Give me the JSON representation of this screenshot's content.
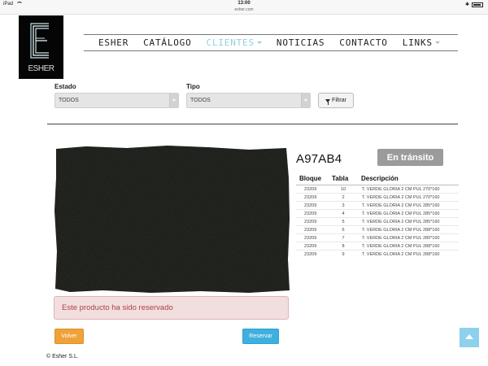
{
  "status_bar": {
    "device": "iPad",
    "time": "13:00",
    "url": "esher.com",
    "battery_icon": "battery-icon",
    "bluetooth": "✱",
    "battery_pct": "",
    "wifi_icon": "wifi-icon"
  },
  "logo": {
    "text": "ESHER"
  },
  "nav": {
    "items": [
      {
        "label": "ESHER",
        "active": false,
        "dropdown": false
      },
      {
        "label": "CATÁLOGO",
        "active": false,
        "dropdown": false
      },
      {
        "label": "CLIENTES",
        "active": true,
        "dropdown": true
      },
      {
        "label": "NOTICIAS",
        "active": false,
        "dropdown": false
      },
      {
        "label": "CONTACTO",
        "active": false,
        "dropdown": false
      },
      {
        "label": "LINKS",
        "active": false,
        "dropdown": true
      }
    ],
    "active_color": "#8fd1e0"
  },
  "filters": {
    "estado_label": "Estado",
    "estado_value": "TODOS",
    "tipo_label": "Tipo",
    "tipo_value": "TODOS",
    "filter_button": "Filtrar"
  },
  "product": {
    "code": "A97AB4",
    "status": "En tránsito",
    "headers": {
      "bloque": "Bloque",
      "tabla": "Tabla",
      "descripcion": "Descripción"
    },
    "rows": [
      {
        "bloque": "23209",
        "tabla": "10",
        "descripcion": "T. VERDE GLORIA 2 CM PUL 270*160"
      },
      {
        "bloque": "23209",
        "tabla": "2",
        "descripcion": "T. VERDE GLORIA 2 CM PUL 270*160"
      },
      {
        "bloque": "23209",
        "tabla": "3",
        "descripcion": "T. VERDE GLORIA 2 CM PUL 285*160"
      },
      {
        "bloque": "23209",
        "tabla": "4",
        "descripcion": "T. VERDE GLORIA 2 CM PUL 285*160"
      },
      {
        "bloque": "23209",
        "tabla": "5",
        "descripcion": "T. VERDE GLORIA 2 CM PUL 285*160"
      },
      {
        "bloque": "23209",
        "tabla": "6",
        "descripcion": "T. VERDE GLORIA 2 CM PUL 288*160"
      },
      {
        "bloque": "23209",
        "tabla": "7",
        "descripcion": "T. VERDE GLORIA 2 CM PUL 280*160"
      },
      {
        "bloque": "23209",
        "tabla": "8",
        "descripcion": "T. VERDE GLORIA 2 CM PUL 288*160"
      },
      {
        "bloque": "23209",
        "tabla": "9",
        "descripcion": "T. VERDE GLORIA 2 CM PUL 288*160"
      }
    ],
    "alert": "Este producto ha sido reservado"
  },
  "actions": {
    "back": "Volver",
    "reserve": "Reservar"
  },
  "footer": {
    "copyright": "© Esher S.L."
  },
  "colors": {
    "reserve": "#3fb0de",
    "back": "#efa13a",
    "badge": "#9b9b9b",
    "alert_bg": "#f2dede",
    "alert_text": "#a94442"
  }
}
